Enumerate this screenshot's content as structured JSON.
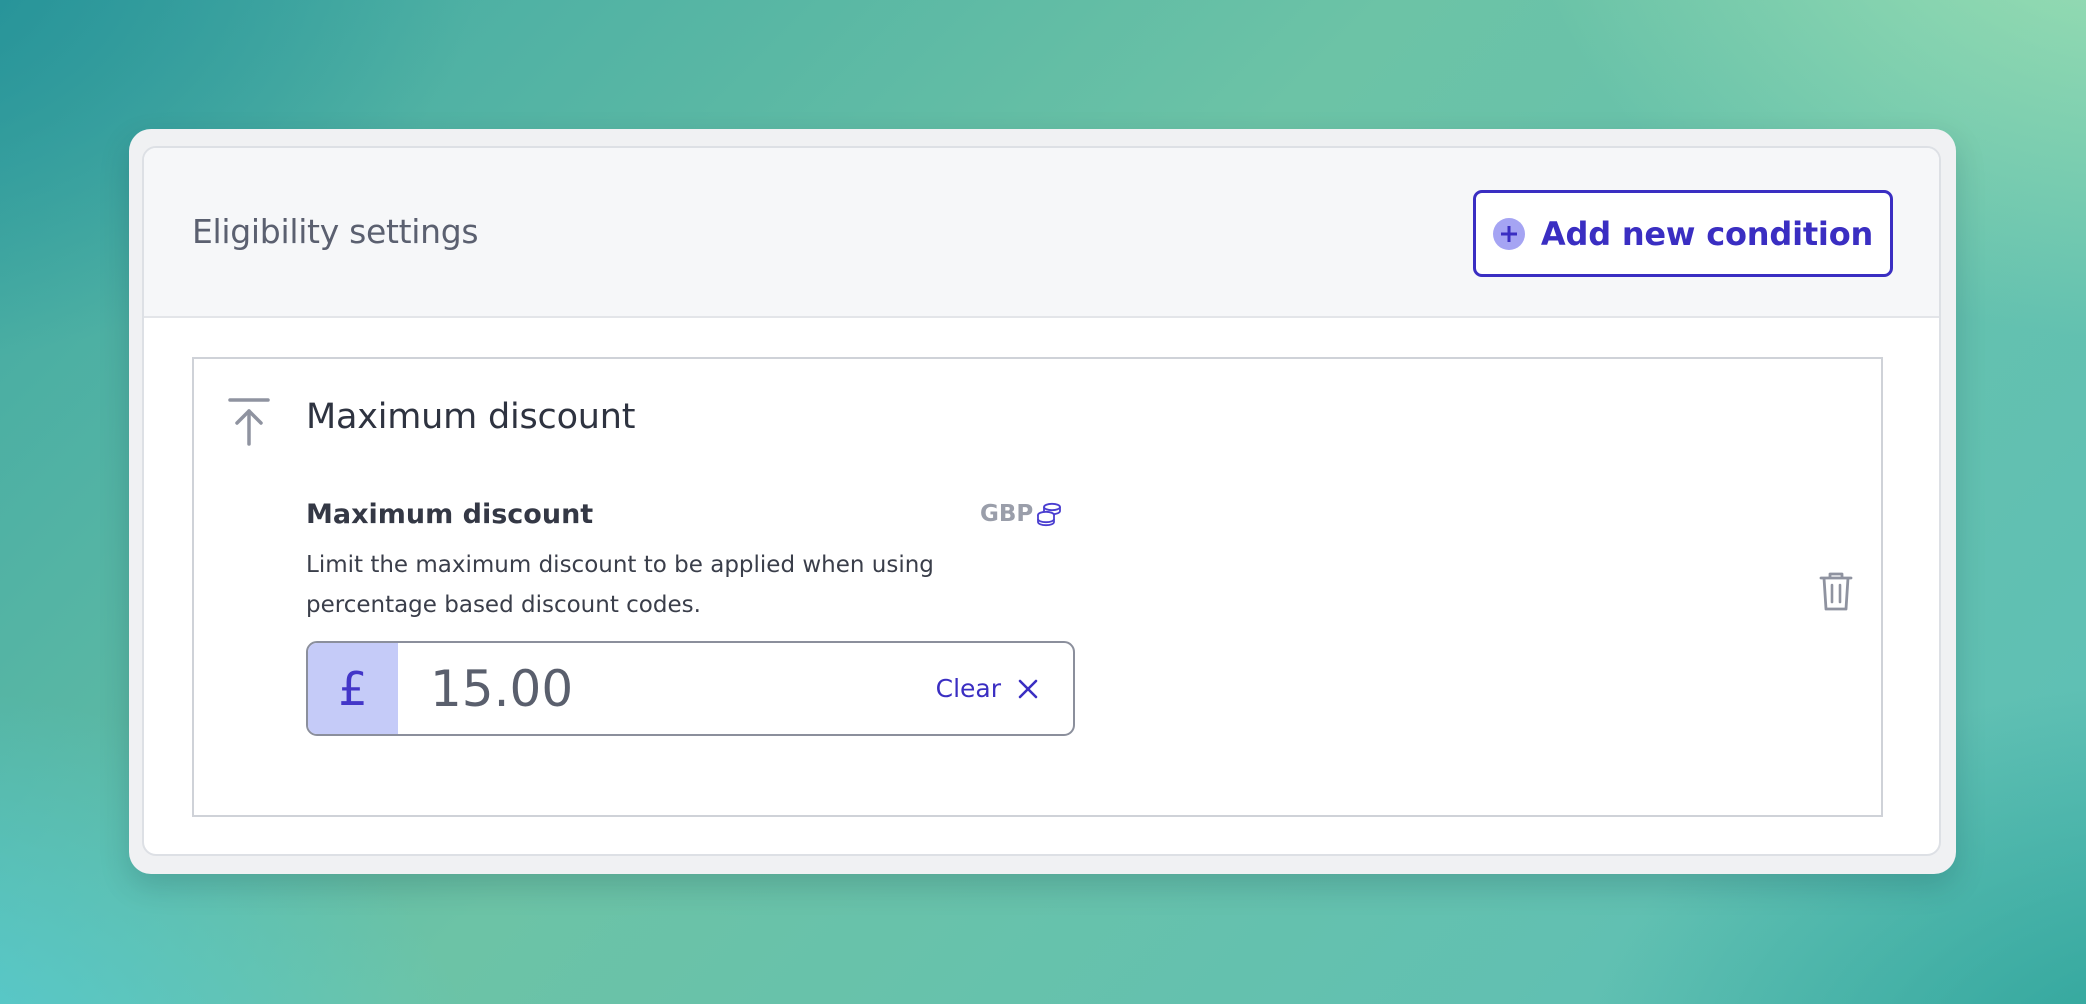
{
  "header": {
    "title": "Eligibility settings",
    "add_button_label": "Add new condition"
  },
  "condition": {
    "title": "Maximum discount",
    "field_label": "Maximum discount",
    "currency_code": "GBP",
    "description": "Limit the maximum discount to be applied when using percentage based discount codes.",
    "currency_symbol": "£",
    "value": "15.00",
    "clear_label": "Clear"
  },
  "icons": {
    "add": "plus-circle-icon",
    "condition": "arrow-up-to-line-icon",
    "currency": "coins-icon",
    "clear": "close-icon",
    "delete": "trash-icon"
  },
  "colors": {
    "accent": "#3a2ec2",
    "prefix_bg": "#c5cbf8"
  }
}
